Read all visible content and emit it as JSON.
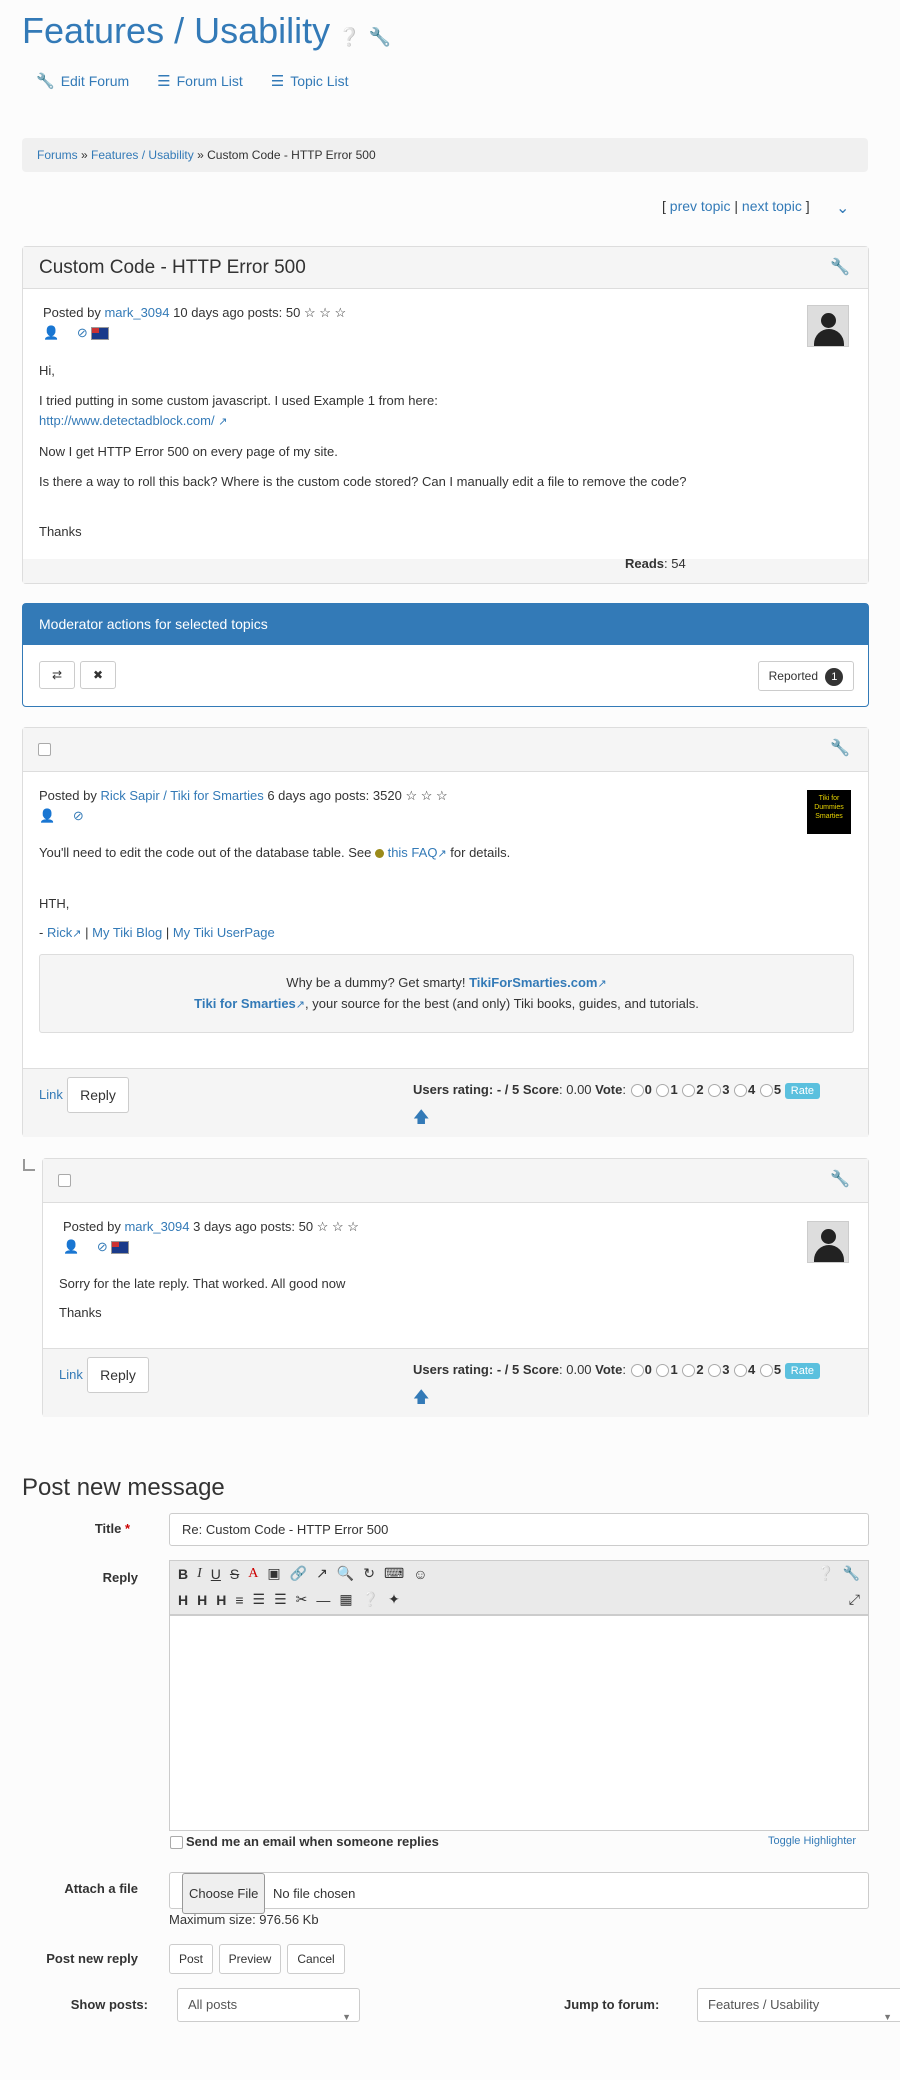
{
  "page": {
    "title": "Features / Usability",
    "help_icon": "question-circle-icon",
    "wrench_icon": "wrench-icon"
  },
  "topnav": {
    "edit_forum": "Edit Forum",
    "forum_list": "Forum List",
    "topic_list": "Topic List"
  },
  "breadcrumb": {
    "forums": "Forums",
    "sep": "»",
    "forum": "Features / Usability",
    "current": "Custom Code - HTTP Error 500"
  },
  "topic_nav": {
    "open": "[",
    "prev": "prev topic",
    "sep": "|",
    "next": "next topic",
    "close": "]"
  },
  "first_post": {
    "title": "Custom Code - HTTP Error 500",
    "posted_by": "Posted by",
    "author": "mark_3094",
    "when": "10 days ago",
    "posts_label": "posts:",
    "posts": "50",
    "stars": "☆ ☆ ☆",
    "body": {
      "greeting": "Hi,",
      "line1": "I tried putting in some custom javascript. I used Example 1 from here:",
      "link": "http://www.detectadblock.com/",
      "line2": "Now I get HTTP Error 500 on every page of my site.",
      "line3": "Is there a way to roll this back? Where is the custom code stored? Can I manually edit a file to remove the code?",
      "thanks": "Thanks"
    },
    "reads_label": "Reads",
    "reads_value": ": 54"
  },
  "moderator": {
    "title": "Moderator actions for selected topics",
    "reported_label": "Reported",
    "reported_count": "1"
  },
  "reply1": {
    "posted_by": "Posted by",
    "author": "Rick Sapir / Tiki for Smarties",
    "when": "6 days ago",
    "posts_label": "posts:",
    "posts": "3520",
    "stars": "☆ ☆ ☆",
    "avatar_text": "Tiki for Dummies Smarties",
    "body_pre": "You'll need to edit the code out of the database table. See",
    "faq_link": "this FAQ",
    "body_post": "for details.",
    "hth": "HTH,",
    "sig_dash": "-",
    "sig_rick": "Rick",
    "sig_blog": "My Tiki Blog",
    "sig_userpage": "My Tiki UserPage",
    "box_line1_pre": "Why be a dummy? Get smarty!",
    "box_line1_link": "TikiForSmarties.com",
    "box_line2_link": "Tiki for Smarties",
    "box_line2_post": ", your source for the best (and only) Tiki books, guides, and tutorials.",
    "link_label": "Link",
    "reply_label": "Reply"
  },
  "reply2": {
    "posted_by": "Posted by",
    "author": "mark_3094",
    "when": "3 days ago",
    "posts_label": "posts:",
    "posts": "50",
    "stars": "☆ ☆ ☆",
    "line1": "Sorry for the late reply. That worked. All good now",
    "thanks": "Thanks",
    "link_label": "Link",
    "reply_label": "Reply"
  },
  "rating": {
    "users_rating_label": "Users rating:",
    "users_rating_value": "- / 5",
    "score_label": "Score",
    "score_value": ": 0.00",
    "vote_label": "Vote",
    "options": [
      "0",
      "1",
      "2",
      "3",
      "4",
      "5"
    ],
    "rate_button": "Rate"
  },
  "post_form": {
    "heading": "Post new message",
    "title_label": "Title",
    "required_mark": "*",
    "title_value": "Re: Custom Code - HTTP Error 500",
    "reply_label": "Reply",
    "email_label": "Send me an email when someone replies",
    "toggle_highlighter": "Toggle Highlighter",
    "attach_label": "Attach a file",
    "choose_file": "Choose File",
    "no_file": "No file chosen",
    "max_size": "Maximum size: 976.56 Kb",
    "post_new_reply_label": "Post new reply",
    "post_button": "Post",
    "preview_button": "Preview",
    "cancel_button": "Cancel",
    "show_posts_label": "Show posts:",
    "show_posts_value": "All posts",
    "jump_label": "Jump to forum:",
    "jump_value": "Features / Usability"
  },
  "colors": {
    "accent": "#337ab7",
    "moderator_header": "#337ab7",
    "rate_button": "#5bc0de"
  }
}
